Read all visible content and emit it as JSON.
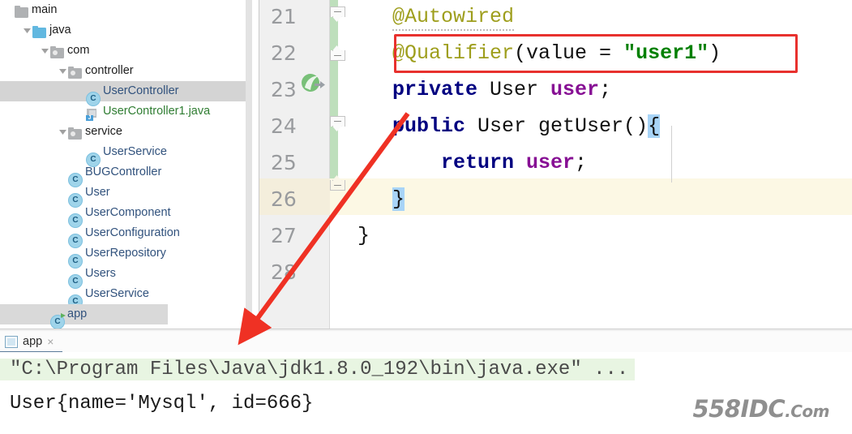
{
  "project_tree": {
    "items": [
      {
        "label": "main",
        "icon": "folder-gray-icon",
        "indent": 0,
        "twisty": "none",
        "kind": "folder"
      },
      {
        "label": "java",
        "icon": "folder-blue-icon",
        "indent": 1,
        "twisty": "expanded",
        "kind": "folder"
      },
      {
        "label": "com",
        "icon": "folder-package-icon",
        "indent": 2,
        "twisty": "expanded",
        "kind": "folder"
      },
      {
        "label": "controller",
        "icon": "folder-package-icon",
        "indent": 3,
        "twisty": "expanded",
        "kind": "folder"
      },
      {
        "label": "UserController",
        "icon": "java-class-icon",
        "indent": 4,
        "twisty": "none",
        "kind": "class",
        "selected": true
      },
      {
        "label": "UserController1.java",
        "icon": "java-file-icon",
        "indent": 4,
        "twisty": "none",
        "kind": "javafile"
      },
      {
        "label": "service",
        "icon": "folder-package-icon",
        "indent": 3,
        "twisty": "expanded",
        "kind": "folder"
      },
      {
        "label": "UserService",
        "icon": "java-class-icon",
        "indent": 4,
        "twisty": "none",
        "kind": "class"
      },
      {
        "label": "BUGController",
        "icon": "java-class-icon",
        "indent": 3,
        "twisty": "none",
        "kind": "class"
      },
      {
        "label": "User",
        "icon": "java-class-icon",
        "indent": 3,
        "twisty": "none",
        "kind": "class"
      },
      {
        "label": "UserComponent",
        "icon": "java-class-icon",
        "indent": 3,
        "twisty": "none",
        "kind": "class"
      },
      {
        "label": "UserConfiguration",
        "icon": "java-class-icon",
        "indent": 3,
        "twisty": "none",
        "kind": "class"
      },
      {
        "label": "UserRepository",
        "icon": "java-class-icon",
        "indent": 3,
        "twisty": "none",
        "kind": "class"
      },
      {
        "label": "Users",
        "icon": "java-class-icon",
        "indent": 3,
        "twisty": "none",
        "kind": "class"
      },
      {
        "label": "UserService",
        "icon": "java-class-icon",
        "indent": 3,
        "twisty": "none",
        "kind": "class"
      },
      {
        "label": "app",
        "icon": "java-class-runnable-icon",
        "indent": 2,
        "twisty": "none",
        "kind": "class",
        "partial": true
      }
    ]
  },
  "editor": {
    "lines": [
      {
        "number": "21",
        "tokens": [
          {
            "t": "@Autowired",
            "c": "anno",
            "squiggle": true
          }
        ],
        "indent": 1
      },
      {
        "number": "22",
        "tokens": [
          {
            "t": "@Qualifier",
            "c": "anno"
          },
          {
            "t": "(value = ",
            "c": "plain"
          },
          {
            "t": "\"user1\"",
            "c": "str"
          },
          {
            "t": ")",
            "c": "plain"
          }
        ],
        "indent": 1,
        "boxed": true
      },
      {
        "number": "23",
        "tokens": [
          {
            "t": "private ",
            "c": "kw"
          },
          {
            "t": "User ",
            "c": "type"
          },
          {
            "t": "user",
            "c": "field"
          },
          {
            "t": ";",
            "c": "plain"
          }
        ],
        "indent": 1,
        "gutter_icon": "spring-bean-icon"
      },
      {
        "number": "24",
        "tokens": [
          {
            "t": "public ",
            "c": "kw"
          },
          {
            "t": "User getUser()",
            "c": "type"
          },
          {
            "t": "{",
            "c": "brace-hl"
          }
        ],
        "indent": 1
      },
      {
        "number": "25",
        "tokens": [
          {
            "t": "    return ",
            "c": "kw"
          },
          {
            "t": "user",
            "c": "field"
          },
          {
            "t": ";",
            "c": "plain"
          }
        ],
        "indent": 1
      },
      {
        "number": "26",
        "tokens": [
          {
            "t": "}",
            "c": "brace-hl"
          }
        ],
        "indent": 1,
        "current": true
      },
      {
        "number": "27",
        "tokens": [
          {
            "t": "}",
            "c": "plain"
          }
        ],
        "indent": 0
      },
      {
        "number": "28",
        "tokens": [],
        "indent": 0
      }
    ]
  },
  "console": {
    "tab_label": "app",
    "tab_close": "×",
    "command_line": "\"C:\\Program Files\\Java\\jdk1.8.0_192\\bin\\java.exe\" ...",
    "output_line": "User{name='Mysql', id=666}"
  },
  "watermark": {
    "main": "558IDC",
    "suffix": ".Com"
  },
  "colors": {
    "annotation": "#9e9e1c",
    "keyword": "#000080",
    "string": "#008000",
    "field": "#871094",
    "highlight_box": "#e8312e",
    "current_line": "#fcf8e4",
    "brace_match": "#a8d4f7",
    "console_cmd_bg": "#e8f5e2",
    "vcs_added": "#bedfbc",
    "selection": "#d4d4d4"
  }
}
